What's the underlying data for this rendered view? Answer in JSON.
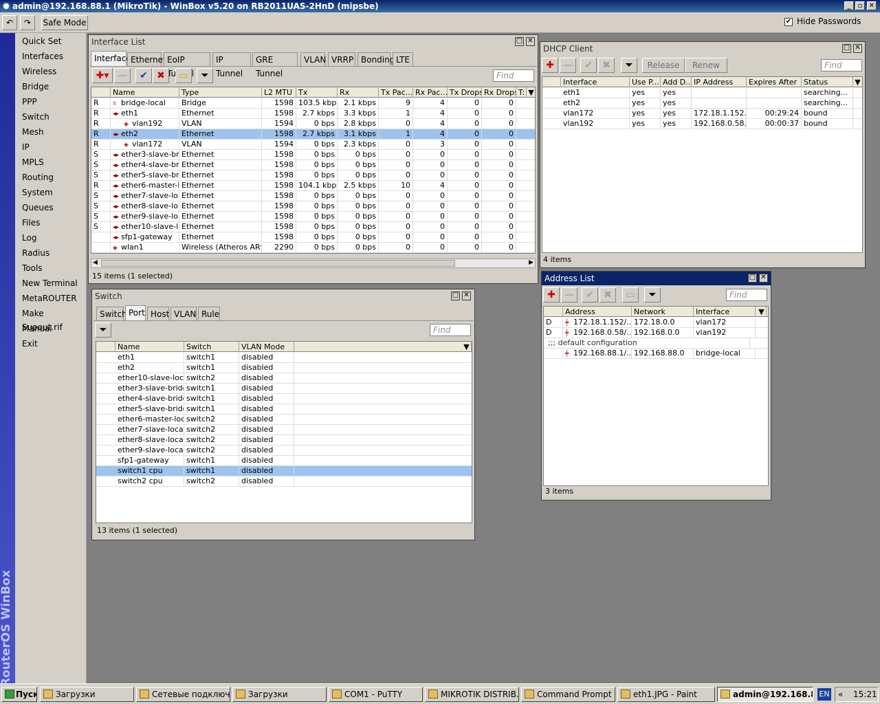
{
  "app": {
    "title": "admin@192.168.88.1 (MikroTik) - WinBox v5.20 on RB2011UAS-2HnD (mipsbe)",
    "safe_mode": "Safe Mode",
    "hide_passwords": "Hide Passwords",
    "sidebar_text": "RouterOS WinBox"
  },
  "menu": [
    "Quick Set",
    "Interfaces",
    "Wireless",
    "Bridge",
    "PPP",
    "Switch",
    "Mesh",
    "IP",
    "MPLS",
    "Routing",
    "System",
    "Queues",
    "Files",
    "Log",
    "Radius",
    "Tools",
    "New Terminal",
    "MetaROUTER",
    "Make Supout.rif",
    "Manual",
    "Exit"
  ],
  "iface": {
    "title": "Interface List",
    "tabs": [
      "Interface",
      "Ethernet",
      "EoIP Tunnel",
      "IP Tunnel",
      "GRE Tunnel",
      "VLAN",
      "VRRP",
      "Bonding",
      "LTE"
    ],
    "find": "Find",
    "cols": [
      "Name",
      "Type",
      "L2 MTU",
      "Tx",
      "Rx",
      "Tx Pac...",
      "Rx Pac...",
      "Tx Drops",
      "Rx Drops",
      "T:"
    ],
    "rows": [
      [
        "R",
        "bridge-local",
        "Bridge",
        "1598",
        "103.5 kbps",
        "2.1 kbps",
        "9",
        "4",
        "0",
        "0"
      ],
      [
        "R",
        "eth1",
        "Ethernet",
        "1598",
        "2.7 kbps",
        "3.3 kbps",
        "1",
        "4",
        "0",
        "0"
      ],
      [
        "R",
        "vlan192",
        "VLAN",
        "1594",
        "0 bps",
        "2.8 kbps",
        "0",
        "4",
        "0",
        "0"
      ],
      [
        "R",
        "eth2",
        "Ethernet",
        "1598",
        "2.7 kbps",
        "3.1 kbps",
        "1",
        "4",
        "0",
        "0"
      ],
      [
        "R",
        "vlan172",
        "VLAN",
        "1594",
        "0 bps",
        "2.3 kbps",
        "0",
        "3",
        "0",
        "0"
      ],
      [
        "S",
        "ether3-slave-br...",
        "Ethernet",
        "1598",
        "0 bps",
        "0 bps",
        "0",
        "0",
        "0",
        "0"
      ],
      [
        "S",
        "ether4-slave-br...",
        "Ethernet",
        "1598",
        "0 bps",
        "0 bps",
        "0",
        "0",
        "0",
        "0"
      ],
      [
        "S",
        "ether5-slave-br...",
        "Ethernet",
        "1598",
        "0 bps",
        "0 bps",
        "0",
        "0",
        "0",
        "0"
      ],
      [
        "R",
        "ether6-master-l...",
        "Ethernet",
        "1598",
        "104.1 kbps",
        "2.5 kbps",
        "10",
        "4",
        "0",
        "0"
      ],
      [
        "S",
        "ether7-slave-lo...",
        "Ethernet",
        "1598",
        "0 bps",
        "0 bps",
        "0",
        "0",
        "0",
        "0"
      ],
      [
        "S",
        "ether8-slave-lo...",
        "Ethernet",
        "1598",
        "0 bps",
        "0 bps",
        "0",
        "0",
        "0",
        "0"
      ],
      [
        "S",
        "ether9-slave-lo...",
        "Ethernet",
        "1598",
        "0 bps",
        "0 bps",
        "0",
        "0",
        "0",
        "0"
      ],
      [
        "S",
        "ether10-slave-l...",
        "Ethernet",
        "1598",
        "0 bps",
        "0 bps",
        "0",
        "0",
        "0",
        "0"
      ],
      [
        "",
        "sfp1-gateway",
        "Ethernet",
        "1598",
        "0 bps",
        "0 bps",
        "0",
        "0",
        "0",
        "0"
      ],
      [
        "",
        "wlan1",
        "Wireless (Atheros AR9...",
        "2290",
        "0 bps",
        "0 bps",
        "0",
        "0",
        "0",
        "0"
      ]
    ],
    "status": "15 items (1 selected)"
  },
  "dhcp": {
    "title": "DHCP Client",
    "release": "Release",
    "renew": "Renew",
    "find": "Find",
    "cols": [
      "Interface",
      "Use P...",
      "Add D...",
      "IP Address",
      "Expires After",
      "Status"
    ],
    "rows": [
      [
        "eth1",
        "yes",
        "yes",
        "",
        "",
        "searching..."
      ],
      [
        "eth2",
        "yes",
        "yes",
        "",
        "",
        "searching..."
      ],
      [
        "vlan172",
        "yes",
        "yes",
        "172.18.1.152...",
        "00:29:24",
        "bound"
      ],
      [
        "vlan192",
        "yes",
        "yes",
        "192.168.0.58...",
        "00:00:37",
        "bound"
      ]
    ],
    "status": "4 items"
  },
  "addr": {
    "title": "Address List",
    "find": "Find",
    "cols": [
      "Address",
      "Network",
      "Interface"
    ],
    "rows": [
      [
        "D",
        "172.18.1.152/...",
        "172.18.0.0",
        "vlan172"
      ],
      [
        "D",
        "192.168.0.58/...",
        "192.168.0.0",
        "vlan192"
      ]
    ],
    "comment": ";;; default configuration",
    "row3": [
      "",
      "192.168.88.1/...",
      "192.168.88.0",
      "bridge-local"
    ],
    "status": "3 items"
  },
  "sw": {
    "title": "Switch",
    "tabs": [
      "Switch",
      "Port",
      "Host",
      "VLAN",
      "Rule"
    ],
    "find": "Find",
    "cols": [
      "Name",
      "Switch",
      "VLAN Mode"
    ],
    "rows": [
      [
        "eth1",
        "switch1",
        "disabled"
      ],
      [
        "eth2",
        "switch1",
        "disabled"
      ],
      [
        "ether10-slave-local",
        "switch2",
        "disabled"
      ],
      [
        "ether3-slave-bridge",
        "switch1",
        "disabled"
      ],
      [
        "ether4-slave-bridge",
        "switch1",
        "disabled"
      ],
      [
        "ether5-slave-bridge",
        "switch1",
        "disabled"
      ],
      [
        "ether6-master-local",
        "switch2",
        "disabled"
      ],
      [
        "ether7-slave-local",
        "switch2",
        "disabled"
      ],
      [
        "ether8-slave-local",
        "switch2",
        "disabled"
      ],
      [
        "ether9-slave-local",
        "switch2",
        "disabled"
      ],
      [
        "sfp1-gateway",
        "switch1",
        "disabled"
      ],
      [
        "switch1 cpu",
        "switch1",
        "disabled"
      ],
      [
        "switch2 cpu",
        "switch2",
        "disabled"
      ]
    ],
    "status": "13 items (1 selected)"
  },
  "taskbar": {
    "start": "Пуск",
    "tasks": [
      "Загрузки",
      "Сетевые подключ...",
      "Загрузки",
      "COM1 - PuTTY",
      "MIKROTIK DISTRIB...",
      "Command Prompt",
      "eth1.JPG - Paint",
      "admin@192.168.8..."
    ],
    "lang": "EN",
    "clock": "15:21"
  }
}
